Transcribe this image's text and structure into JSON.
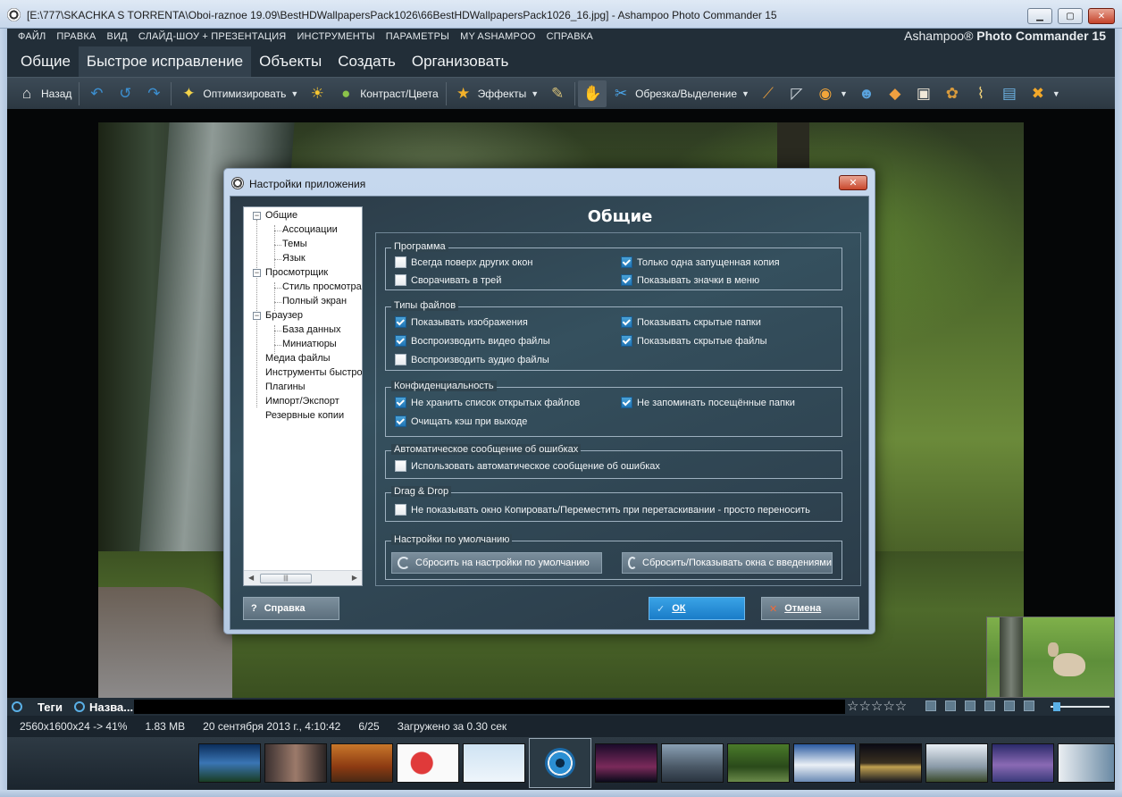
{
  "window": {
    "title": "[E:\\777\\SKACHKA S TORRENTA\\Oboi-raznoe 19.09\\BestHDWallpapersPack1026\\66BestHDWallpapersPack1026_16.jpg] - Ashampoo Photo Commander 15",
    "minimize_icon": "minimize-icon",
    "maximize_icon": "maximize-icon",
    "close_icon": "close-icon"
  },
  "menu": {
    "items": [
      "ФАЙЛ",
      "ПРАВКА",
      "ВИД",
      "СЛАЙД-ШОУ + ПРЕЗЕНТАЦИЯ",
      "ИНСТРУМЕНТЫ",
      "ПАРАМЕТРЫ",
      "MY ASHAMPOO",
      "СПРАВКА"
    ],
    "brand_prefix": "Ashampoo®",
    "brand_name": "Photo Commander 15"
  },
  "tabs": [
    "Общие",
    "Быстрое исправление",
    "Объекты",
    "Создать",
    "Организовать"
  ],
  "toolbar": {
    "back": "Назад",
    "optimize": "Оптимизировать",
    "contrast": "Контраст/Цвета",
    "effects": "Эффекты",
    "crop": "Обрезка/Выделение"
  },
  "dialog": {
    "title": "Настройки приложения",
    "heading": "Общие",
    "tree": {
      "general": "Общие",
      "associations": "Ассоциации",
      "themes": "Темы",
      "language": "Язык",
      "viewer": "Просмотрщик",
      "view_style": "Стиль просмотра",
      "fullscreen": "Полный экран",
      "browser": "Браузер",
      "database": "База данных",
      "thumbnails": "Миниатюры",
      "media": "Медиа файлы",
      "quick_tools": "Инструменты быстро",
      "plugins": "Плагины",
      "import_export": "Импорт/Экспорт",
      "backups": "Резервные копии"
    },
    "groups": {
      "program": {
        "legend": "Программа",
        "always_on_top": {
          "label": "Всегда поверх других окон",
          "checked": false
        },
        "single_instance": {
          "label": "Только одна запущенная копия",
          "checked": true
        },
        "minimize_tray": {
          "label": "Сворачивать в трей",
          "checked": false
        },
        "menu_icons": {
          "label": "Показывать значки в меню",
          "checked": true
        }
      },
      "filetypes": {
        "legend": "Типы файлов",
        "show_images": {
          "label": "Показывать изображения",
          "checked": true
        },
        "show_hidden_folders": {
          "label": "Показывать скрытые папки",
          "checked": true
        },
        "play_video": {
          "label": "Воспроизводить видео файлы",
          "checked": true
        },
        "show_hidden_files": {
          "label": "Показывать скрытые файлы",
          "checked": true
        },
        "play_audio": {
          "label": "Воспроизводить аудио файлы",
          "checked": false
        }
      },
      "privacy": {
        "legend": "Конфиденциальность",
        "no_recent_files": {
          "label": "Не хранить список открытых файлов",
          "checked": true
        },
        "no_visited_folders": {
          "label": "Не запоминать посещённые папки",
          "checked": true
        },
        "clear_cache": {
          "label": "Очищать кэш при выходе",
          "checked": true
        }
      },
      "errors": {
        "legend": "Автоматическое сообщение об ошибках",
        "auto_report": {
          "label": "Использовать автоматическое сообщение об ошибках",
          "checked": false
        }
      },
      "dragdrop": {
        "legend": "Drag & Drop",
        "no_copy_move": {
          "label": "Не показывать окно Копировать/Переместить при перетаскивании - просто переносить",
          "checked": false
        }
      },
      "defaults": {
        "legend": "Настройки по умолчанию",
        "reset_defaults": "Сбросить на настройки по умолчанию",
        "reset_intro": "Сбросить/Показывать окна с введениями"
      }
    },
    "buttons": {
      "help_mark": "?",
      "help": "Справка",
      "ok": "ОК",
      "cancel": "Отмена"
    }
  },
  "bottom_tabs": [
    "Теги",
    "Назва..."
  ],
  "rating": "☆☆☆☆☆",
  "status": {
    "resolution": "2560x1600x24 -> 41%",
    "size": "1.83 MB",
    "date": "20 сентября 2013 г., 4:10:42",
    "position": "6/25",
    "loaded": "Загружено за 0.30 сек"
  },
  "colors": {
    "accent_blue": "#2a8fd8",
    "ok_button": "#1e7fc9",
    "checkbox_on": "#2a86c6",
    "close_red": "#c9472c"
  }
}
